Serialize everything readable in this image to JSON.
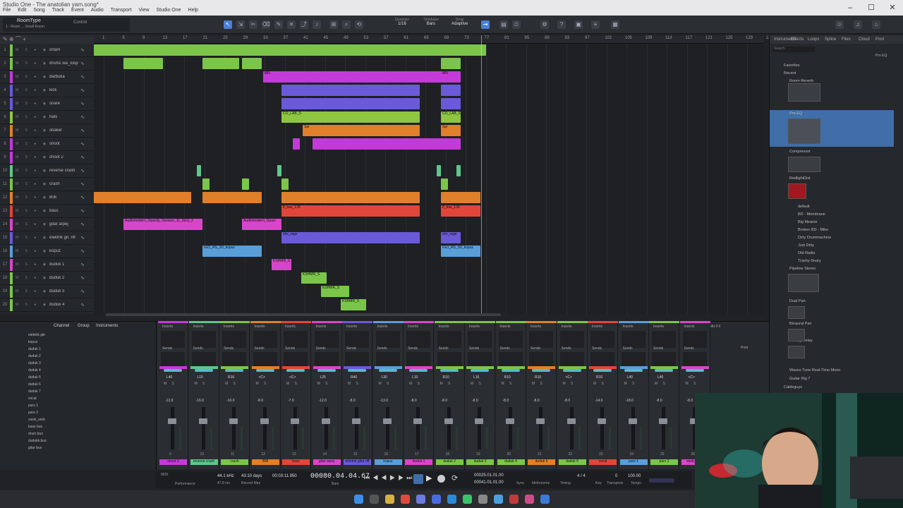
{
  "window": {
    "title": "Studio One - The anatolian yarn.song*"
  },
  "menu": [
    "File",
    "Edit",
    "Song",
    "Track",
    "Event",
    "Audio",
    "Transport",
    "View",
    "Studio One",
    "Help"
  ],
  "toolbar": {
    "preset": "RoomType",
    "preset_sub": "1 - Room ...  Small Room",
    "control": "Control",
    "quantize_label": "Quantize",
    "quantize": "1/16",
    "timebase_label": "Timebase",
    "timebase": "Bars",
    "snap_label": "Snap",
    "snap": "Adaptive"
  },
  "ruler": [
    "1",
    "5",
    "9",
    "13",
    "17",
    "21",
    "25",
    "29",
    "33",
    "37",
    "41",
    "45",
    "49",
    "53",
    "57",
    "61",
    "65",
    "69",
    "73",
    "77",
    "81",
    "85",
    "89",
    "93",
    "97",
    "101",
    "105",
    "109",
    "113",
    "117",
    "121",
    "125",
    "129",
    "133"
  ],
  "tracks": [
    {
      "n": "1",
      "name": "ortam",
      "color": "#7bc64a"
    },
    {
      "n": "2",
      "name": "drums wa_loop",
      "color": "#7bc64a"
    },
    {
      "n": "3",
      "name": "darbuka",
      "color": "#c43ad8"
    },
    {
      "n": "4",
      "name": "kick",
      "color": "#6a5ad8"
    },
    {
      "n": "5",
      "name": "snare",
      "color": "#6a5ad8"
    },
    {
      "n": "6",
      "name": "hats",
      "color": "#8ec641"
    },
    {
      "n": "7",
      "name": "shaker",
      "color": "#e0802a"
    },
    {
      "n": "8",
      "name": "shoot",
      "color": "#c43ad8"
    },
    {
      "n": "9",
      "name": "shoot 2",
      "color": "#c43ad8"
    },
    {
      "n": "10",
      "name": "reverse crash",
      "color": "#5ec68a"
    },
    {
      "n": "11",
      "name": "crash",
      "color": "#7bc64a"
    },
    {
      "n": "12",
      "name": "808",
      "color": "#e0802a"
    },
    {
      "n": "13",
      "name": "bass",
      "color": "#e0463a"
    },
    {
      "n": "14",
      "name": "gitar arpej",
      "color": "#d846c8"
    },
    {
      "n": "15",
      "name": "elektrik git. riff",
      "color": "#6a5ad8"
    },
    {
      "n": "16",
      "name": "kopuz",
      "color": "#5a9ed8"
    },
    {
      "n": "17",
      "name": "duduk 1",
      "color": "#d846c8"
    },
    {
      "n": "18",
      "name": "duduk 2",
      "color": "#7bc64a"
    },
    {
      "n": "19",
      "name": "duduk 3",
      "color": "#7bc64a"
    },
    {
      "n": "20",
      "name": "duduk 4",
      "color": "#7bc64a"
    }
  ],
  "clips": {
    "gitar": "Audiomodern_Opacity_Session_11_SEQ_2",
    "gitar2": "Audiomodern_Opaci",
    "kshmr": "KSHMR_S",
    "bass_clip": "ff_bas_128",
    "riff": "shs_rage",
    "kopuz": "IGO_RS_S0_kopuz",
    "hats": "CO_LAB_S",
    "shaker": "Spr",
    "darb": "MN"
  },
  "browser": {
    "tabs": [
      "Instruments",
      "Effects",
      "Loops",
      "Splice",
      "Files",
      "Cloud",
      "Pool"
    ],
    "search": "Search",
    "crumb": "Pro EQ",
    "items": [
      "Favorites",
      "Recent",
      "Room Reverb",
      "Pro EQ",
      "Compressor",
      "RedlightDist",
      "default",
      "BD - Membrane",
      "Big Meanie",
      "Broken BD - Mike",
      "Dirty Drummachine",
      "Just Dirty",
      "Old Radio",
      "Trashy-Snary",
      "Pipeline Stereo",
      "Dual Pan",
      "Binaural Pan",
      "Analog Delay",
      "Waves Tune Real-Time Mono",
      "Guitar Rig 7",
      "Cableguys"
    ]
  },
  "console": {
    "header": [
      "Channel",
      "Group",
      "Instruments"
    ],
    "list": [
      "elektrik gitr",
      "kopuz",
      "duduk 1",
      "duduk 2",
      "duduk 3",
      "duduk 4",
      "duduk 5",
      "duduk 6",
      "duduk 7",
      "vocal",
      "pars 1",
      "pars 2",
      "vasls_verb",
      "bass bus",
      "drum bus",
      "dudukk bus",
      "gitar bus"
    ],
    "inserts_label": "Inserts",
    "sends_label": "Sends",
    "post_label": "Post",
    "mixfx_label": "Mix FX",
    "channels": [
      {
        "name": "shoot 2",
        "color": "#c43ad8",
        "num": "9",
        "pan": "L40",
        "vol": "-12.0"
      },
      {
        "name": "reverse crash",
        "color": "#5ec68a",
        "num": "10",
        "pan": "L15",
        "vol": "-16.0"
      },
      {
        "name": "crash",
        "color": "#7bc64a",
        "num": "11",
        "pan": "R16",
        "vol": "-10.0"
      },
      {
        "name": "808",
        "color": "#e0802a",
        "num": "12",
        "pan": "<C>",
        "vol": "-8.0"
      },
      {
        "name": "bass",
        "color": "#e0463a",
        "num": "13",
        "pan": "<C>",
        "vol": "-7.0"
      },
      {
        "name": "gitar arpej",
        "color": "#d846c8",
        "num": "14",
        "pan": "L25",
        "vol": "-12.0"
      },
      {
        "name": "elektrik gitar riff",
        "color": "#6a5ad8",
        "num": "15",
        "pan": "R40",
        "vol": "-8.0"
      },
      {
        "name": "kopuz",
        "color": "#5a9ed8",
        "num": "16",
        "pan": "L30",
        "vol": "-13.0"
      },
      {
        "name": "duduk 1",
        "color": "#d846c8",
        "num": "17",
        "pan": "L10",
        "vol": "-8.0"
      },
      {
        "name": "duduk 2",
        "color": "#7bc64a",
        "num": "18",
        "pan": "R10",
        "vol": "-8.0"
      },
      {
        "name": "duduk 3",
        "color": "#7bc64a",
        "num": "19",
        "pan": "L10",
        "vol": "-8.0"
      },
      {
        "name": "duduk 4",
        "color": "#7bc64a",
        "num": "20",
        "pan": "R10",
        "vol": "-8.0"
      },
      {
        "name": "duduk 5",
        "color": "#e0802a",
        "num": "21",
        "pan": "R10",
        "vol": "-8.0"
      },
      {
        "name": "duduk 6",
        "color": "#7bc64a",
        "num": "22",
        "pan": "<C>",
        "vol": "-8.0"
      },
      {
        "name": "vocal",
        "color": "#e0463a",
        "num": "23",
        "pan": "R10",
        "vol": "-14.0"
      },
      {
        "name": "pars 1",
        "color": "#5a9ed8",
        "num": "24",
        "pan": "L40",
        "vol": "-18.0"
      },
      {
        "name": "pars 2",
        "color": "#7bc64a",
        "num": "25",
        "pan": "L40",
        "vol": "-8.0"
      },
      {
        "name": "vasls_verb",
        "color": "#d846c8",
        "num": "26",
        "pan": "<C>",
        "vol": "-8.0"
      }
    ]
  },
  "transport": {
    "samplerate": "44.1 kHz",
    "latency": "47.8 ms",
    "rec_days": "43:10 days",
    "rec_label": "Record Max",
    "time": "00:03:11.950",
    "position": "00080.04.04.67",
    "pos_label": "Bars",
    "loopstart": "00025.01.01.00",
    "loopend": "00041.01.01.00",
    "sig": "4 / 4",
    "tempo": "100.00",
    "metronome_label": "Metronome",
    "timing_label": "Timing",
    "key_label": "Key",
    "tempo_label": "Tempo",
    "perf_label": "Performance",
    "midi_label": "MIDI",
    "sync_label": "Sync",
    "transpose_label": "Transpose",
    "transpose": "0"
  }
}
